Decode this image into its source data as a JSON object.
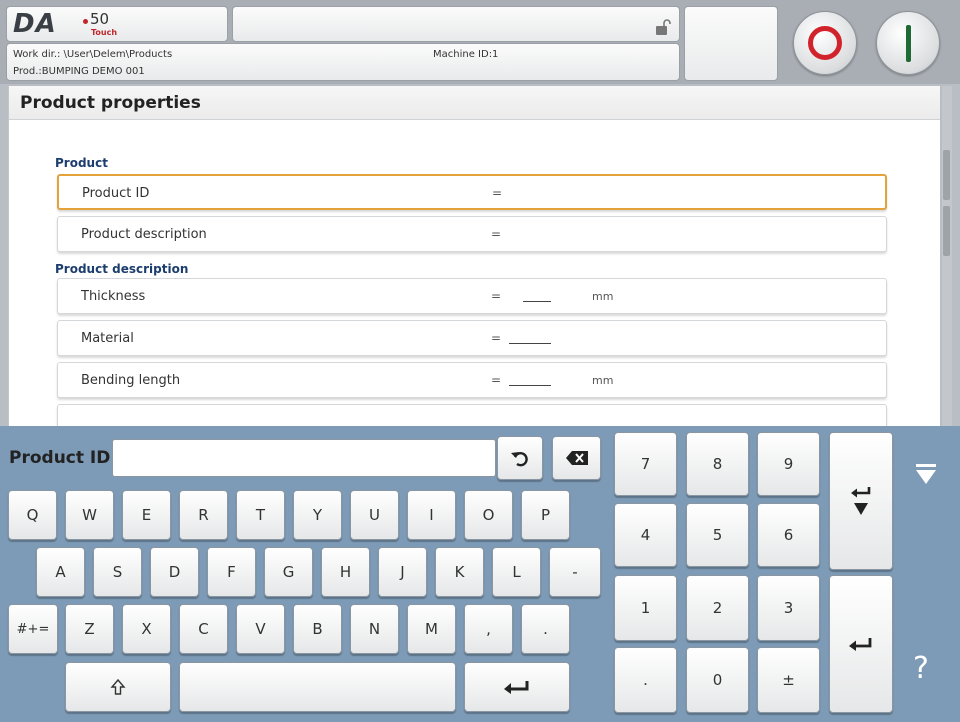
{
  "header": {
    "logo_brand": "DA",
    "logo_model": "50",
    "logo_sub": "Touch",
    "work_dir": "Work dir.: \\User\\Delem\\Products",
    "product": "Prod.:BUMPING DEMO 001",
    "machine_id": "Machine ID:1",
    "accent_stop": "#d1232b",
    "accent_start": "#1f6a34"
  },
  "props": {
    "title": "Product properties",
    "sections": [
      {
        "label": "Product"
      },
      {
        "label": "Product description"
      }
    ],
    "rows": [
      {
        "label": "Product ID",
        "eq": "=",
        "value": "",
        "unit": ""
      },
      {
        "label": "Product description",
        "eq": "=",
        "value": "",
        "unit": ""
      },
      {
        "label": "Thickness",
        "eq": "=",
        "value": "",
        "unit": "mm"
      },
      {
        "label": "Material",
        "eq": "=",
        "value": "",
        "unit": ""
      },
      {
        "label": "Bending length",
        "eq": "=",
        "value": "",
        "unit": "mm"
      }
    ],
    "selected_color": "#e3a23a"
  },
  "keyboard": {
    "input_label": "Product ID",
    "input_value": "",
    "row1": [
      "Q",
      "W",
      "E",
      "R",
      "T",
      "Y",
      "U",
      "I",
      "O",
      "P"
    ],
    "row2": [
      "A",
      "S",
      "D",
      "F",
      "G",
      "H",
      "J",
      "K",
      "L",
      "-"
    ],
    "row3": [
      "#+=",
      "Z",
      "X",
      "C",
      "V",
      "B",
      "N",
      "M",
      ",",
      "."
    ],
    "numpad": [
      "7",
      "8",
      "9",
      "4",
      "5",
      "6",
      "1",
      "2",
      "3",
      ".",
      "0",
      "±"
    ],
    "help": "?",
    "background": "#7d9bb6"
  }
}
